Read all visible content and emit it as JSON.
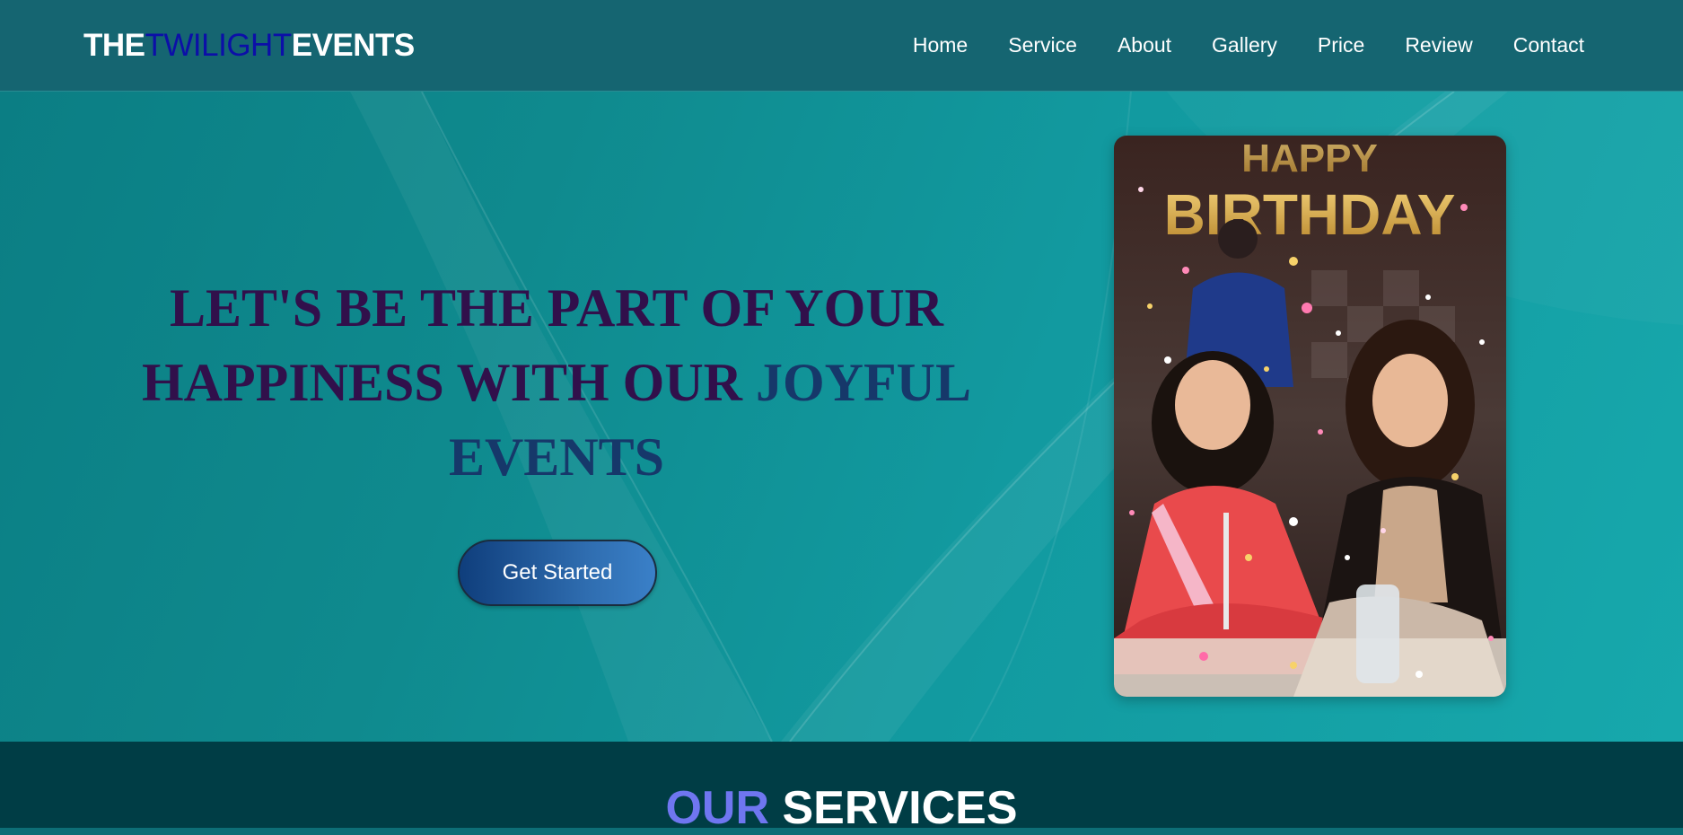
{
  "brand": {
    "logo_part1": "THE",
    "logo_part2": "TWILIGHT",
    "logo_part3": "EVENTS"
  },
  "nav": {
    "items": [
      {
        "label": "Home"
      },
      {
        "label": "Service"
      },
      {
        "label": "About"
      },
      {
        "label": "Gallery"
      },
      {
        "label": "Price"
      },
      {
        "label": "Review"
      },
      {
        "label": "Contact"
      }
    ]
  },
  "hero": {
    "headline_line1": "LET'S BE THE PART OF YOUR",
    "headline_line2": "HAPPINESS WITH OUR ",
    "headline_accent1": "JOYFUL",
    "headline_accent2": "EVENTS",
    "cta_label": "Get Started",
    "photo_banner": "HAPPY BIRTHDAY"
  },
  "services": {
    "heading_accent": "OUR",
    "heading_rest": "SERVICES"
  },
  "colors": {
    "navbar": "#156571",
    "logo_accent": "#0c0fa8",
    "headline": "#31104b",
    "headline_accent": "#16386a",
    "services_bg": "#003d45",
    "services_accent": "#6f76f0"
  },
  "icons": {
    "hero_photo": "birthday-party-photo"
  }
}
